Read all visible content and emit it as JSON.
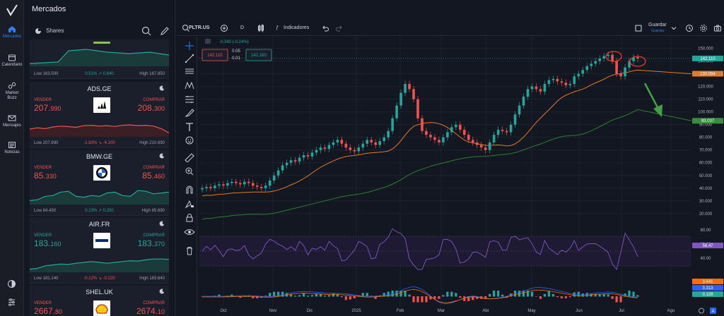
{
  "nav": {
    "items": [
      {
        "label": "Mercados",
        "icon": "home-icon",
        "active": true
      },
      {
        "label": "Calendario",
        "icon": "calendar-icon"
      },
      {
        "label": "Market Buzz",
        "icon": "buzz-icon"
      },
      {
        "label": "Mensajes",
        "icon": "mail-icon"
      },
      {
        "label": "Noticias",
        "icon": "news-icon"
      }
    ]
  },
  "panel": {
    "title": "Mercados",
    "section": "Shares",
    "top_card": {
      "low": "Low 163.500",
      "change": "0.51% ↗ 0.840",
      "high": "High 167.850"
    },
    "cards": [
      {
        "symbol": "ADS.GE",
        "sell_label": "VENDER",
        "buy_label": "COMPRAR",
        "sell_main": "207.",
        "sell_small": "990",
        "buy_main": "208.",
        "buy_small": "300",
        "low": "Low 207.890",
        "change": "-1.93% ↘ -4.100",
        "high": "High 210.690",
        "dir": "down",
        "spark": [
          0.62,
          0.55,
          0.6,
          0.5,
          0.45,
          0.48,
          0.52,
          0.42,
          0.4,
          0.45,
          0.42,
          0.47,
          0.4,
          0.38,
          0.42,
          0.4,
          0.45,
          0.6,
          0.85
        ]
      },
      {
        "symbol": "BMW.GE",
        "sell_label": "VENDER",
        "buy_label": "COMPRAR",
        "sell_main": "85.",
        "sell_small": "330",
        "buy_main": "85.",
        "buy_small": "460",
        "low": "Low 84.430",
        "change": "0.23% ↗ 0.200",
        "high": "High 85.690",
        "dir": "up",
        "spark": [
          0.85,
          0.8,
          0.6,
          0.55,
          0.35,
          0.3,
          0.6,
          0.65,
          0.55,
          0.6,
          0.4,
          0.35,
          0.55,
          0.6,
          0.25,
          0.3,
          0.45,
          0.4,
          0.35
        ]
      },
      {
        "symbol": "AIR.FR",
        "sell_label": "VENDER",
        "buy_label": "COMPRAR",
        "sell_main": "183.",
        "sell_small": "160",
        "buy_main": "183.",
        "buy_small": "370",
        "low": "Low 181.140",
        "change": "-0.12% ↘ -0.220",
        "high": "High 183.640",
        "dir": "up",
        "spark": [
          0.9,
          0.85,
          0.7,
          0.65,
          0.6,
          0.62,
          0.55,
          0.5,
          0.45,
          0.5,
          0.55,
          0.5,
          0.45,
          0.4,
          0.42,
          0.35,
          0.3,
          0.3,
          0.32
        ]
      },
      {
        "symbol": "SHEL.UK",
        "sell_label": "VENDER",
        "buy_label": "COMPRAR",
        "sell_main": "2667.",
        "sell_small": "80",
        "buy_main": "2674.",
        "buy_small": "10"
      }
    ]
  },
  "toolbar": {
    "symbol": "PLTR.US",
    "interval": "D",
    "indicators": "Indicadores",
    "save": "Guardar",
    "save_sub": "Guardar"
  },
  "chart_data": {
    "type": "candlestick",
    "sell_price": "142.110",
    "spread_top": "0.05",
    "spread_bottom": "0.01",
    "buy_price": "142.160",
    "change": "-0.340 (-0.24%)",
    "price_axis": [
      "150.000",
      "140.000",
      "130.000",
      "120.000",
      "110.000",
      "100.000",
      "90.000",
      "80.000",
      "70.000",
      "60.000",
      "50.000",
      "40.000",
      "30.000",
      "20.000"
    ],
    "ylim": [
      16,
      157
    ],
    "rsi_axis": [
      "80.00",
      "60.00",
      "40.00"
    ],
    "time_axis": [
      "Oct",
      "Nov",
      "Dic",
      "2025",
      "Feb",
      "Mar",
      "Abr",
      "May",
      "Jun",
      "Jul",
      "Ago"
    ],
    "badges": {
      "last": "142.110",
      "ma_fast": "130.094",
      "ma_slow": "93.037",
      "rsi": "58.47",
      "macd_a": "3.441",
      "macd_b": "3.313",
      "macd_c": "0.128"
    },
    "series_close": [
      40,
      41,
      40,
      42,
      43,
      42,
      44,
      45,
      44,
      43,
      45,
      44,
      42,
      41,
      40,
      42,
      46,
      50,
      54,
      58,
      60,
      62,
      61,
      64,
      66,
      65,
      68,
      70,
      72,
      71,
      74,
      76,
      78,
      75,
      72,
      70,
      69,
      72,
      75,
      78,
      76,
      74,
      77,
      80,
      85,
      95,
      105,
      115,
      122,
      118,
      110,
      95,
      85,
      82,
      80,
      78,
      76,
      80,
      84,
      88,
      90,
      86,
      82,
      78,
      76,
      74,
      72,
      70,
      76,
      82,
      86,
      85,
      84,
      90,
      98,
      105,
      112,
      118,
      120,
      118,
      116,
      122,
      125,
      126,
      124,
      123,
      121,
      122,
      128,
      130,
      133,
      136,
      138,
      140,
      142,
      144,
      145,
      140,
      130,
      128,
      135,
      140,
      143,
      142
    ]
  }
}
